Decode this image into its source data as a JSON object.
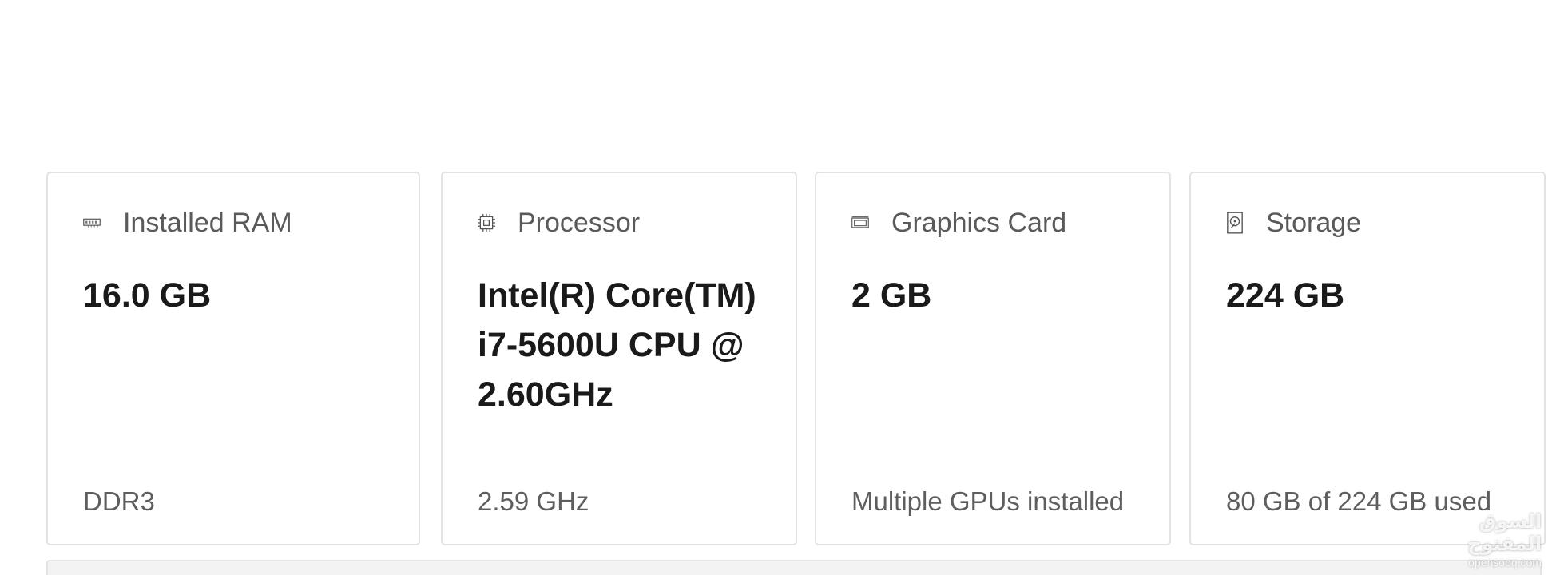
{
  "cards": [
    {
      "title": "Installed RAM",
      "icon": "ram-icon",
      "value": "16.0 GB",
      "footer": "DDR3"
    },
    {
      "title": "Processor",
      "icon": "processor-icon",
      "value": "Intel(R) Core(TM) i7-5600U CPU @ 2.60GHz",
      "footer": "2.59 GHz"
    },
    {
      "title": "Graphics Card",
      "icon": "graphics-card-icon",
      "value": "2 GB",
      "footer": "Multiple GPUs installed"
    },
    {
      "title": "Storage",
      "icon": "storage-icon",
      "value": "224 GB",
      "footer": "80 GB of 224 GB used"
    }
  ],
  "watermark": {
    "main": "السوق المفتوح",
    "sub": "opensooq.com"
  }
}
